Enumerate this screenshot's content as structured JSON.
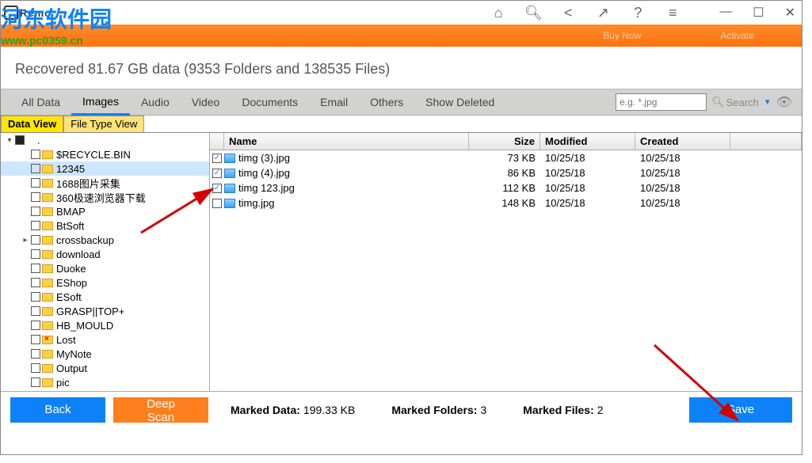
{
  "watermark": {
    "line1": "河东软件园",
    "line2": "www.pc0359.cn"
  },
  "titlebar": {
    "brand": "Remo"
  },
  "orange_bar": {
    "buy": "Buy Now",
    "activate": "Activate"
  },
  "summary": "Recovered 81.67 GB data (9353 Folders and 138535 Files)",
  "tabs": {
    "all": "All Data",
    "images": "Images",
    "audio": "Audio",
    "video": "Video",
    "documents": "Documents",
    "email": "Email",
    "others": "Others",
    "deleted": "Show Deleted"
  },
  "search": {
    "placeholder": "e.g. *.jpg",
    "label": "Search"
  },
  "view_tabs": {
    "data": "Data View",
    "file": "File Type View"
  },
  "tree_root": ".",
  "tree": [
    {
      "name": "$RECYCLE.BIN"
    },
    {
      "name": "12345",
      "selected": true
    },
    {
      "name": "1688图片采集"
    },
    {
      "name": "360极速浏览器下载"
    },
    {
      "name": "BMAP"
    },
    {
      "name": "BtSoft"
    },
    {
      "name": "crossbackup",
      "expandable": true
    },
    {
      "name": "download"
    },
    {
      "name": "Duoke"
    },
    {
      "name": "EShop"
    },
    {
      "name": "ESoft"
    },
    {
      "name": "GRASP||TOP+"
    },
    {
      "name": "HB_MOULD"
    },
    {
      "name": "Lost",
      "deleted": true
    },
    {
      "name": "MyNote"
    },
    {
      "name": "Output"
    },
    {
      "name": "pic"
    }
  ],
  "columns": {
    "name": "Name",
    "size": "Size",
    "modified": "Modified",
    "created": "Created"
  },
  "files": [
    {
      "checked": true,
      "name": "timg (3).jpg",
      "size": "73 KB",
      "modified": "10/25/18",
      "created": "10/25/18"
    },
    {
      "checked": true,
      "name": "timg (4).jpg",
      "size": "86 KB",
      "modified": "10/25/18",
      "created": "10/25/18"
    },
    {
      "checked": true,
      "name": "timg 123.jpg",
      "size": "112 KB",
      "modified": "10/25/18",
      "created": "10/25/18"
    },
    {
      "checked": false,
      "name": "timg.jpg",
      "size": "148 KB",
      "modified": "10/25/18",
      "created": "10/25/18"
    }
  ],
  "bottom": {
    "back": "Back",
    "deep": "Deep Scan",
    "save": "Save",
    "marked_data_label": "Marked Data:",
    "marked_data_value": "199.33 KB",
    "marked_folders_label": "Marked Folders:",
    "marked_folders_value": "3",
    "marked_files_label": "Marked Files:",
    "marked_files_value": "2"
  }
}
